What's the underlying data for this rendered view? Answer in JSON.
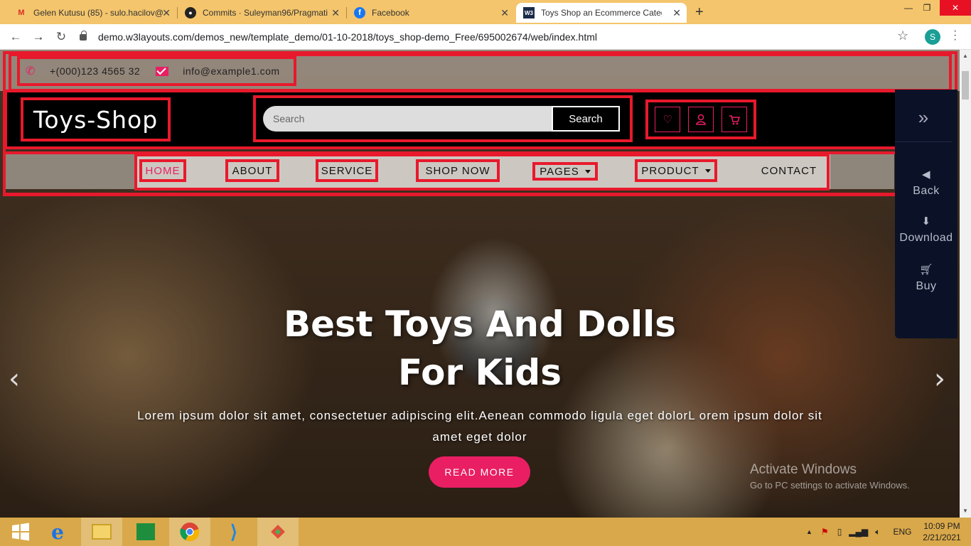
{
  "browser": {
    "tabs": [
      {
        "title": "Gelen Kutusu (85) - sulo.hacilov@",
        "icon": "gmail-icon"
      },
      {
        "title": "Commits · Suleyman96/Pragmati",
        "icon": "github-icon"
      },
      {
        "title": "Facebook",
        "icon": "facebook-icon"
      },
      {
        "title": "Toys Shop an Ecommerce Catego",
        "icon": "w3layouts-icon",
        "active": true
      }
    ],
    "new_tab": "+",
    "url": "demo.w3layouts.com/demos_new/template_demo/01-10-2018/toys_shop-demo_Free/695002674/web/index.html",
    "profile_initial": "S"
  },
  "page": {
    "phone": "+(000)123 4565 32",
    "email": "info@example1.com",
    "logo": "Toys-Shop",
    "search": {
      "placeholder": "Search",
      "button": "Search"
    },
    "nav": [
      {
        "label": "Home",
        "active": true
      },
      {
        "label": "About"
      },
      {
        "label": "Service"
      },
      {
        "label": "Shop Now"
      },
      {
        "label": "Pages",
        "dropdown": true
      },
      {
        "label": "Product",
        "dropdown": true
      },
      {
        "label": "Contact"
      }
    ],
    "side_panel": {
      "back": "Back",
      "download": "Download",
      "buy": "Buy"
    },
    "hero": {
      "title_line1": "Best Toys And Dolls",
      "title_line2": "For Kids",
      "subtitle_line1": "Lorem ipsum dolor sit amet, consectetuer adipiscing elit.Aenean commodo ligula eget dolorL orem ipsum dolor sit",
      "subtitle_line2": "amet eget dolor",
      "button": "READ MORE"
    },
    "activate": {
      "title": "Activate Windows",
      "subtitle": "Go to PC settings to activate Windows."
    }
  },
  "taskbar": {
    "language": "ENG",
    "time": "10:09 PM",
    "date": "2/21/2021"
  },
  "colors": {
    "accent": "#e91e63",
    "annotation": "#e8192c",
    "tabbar": "#f4c56c",
    "taskbar": "#d9a84a",
    "side_panel": "#0b1228"
  }
}
